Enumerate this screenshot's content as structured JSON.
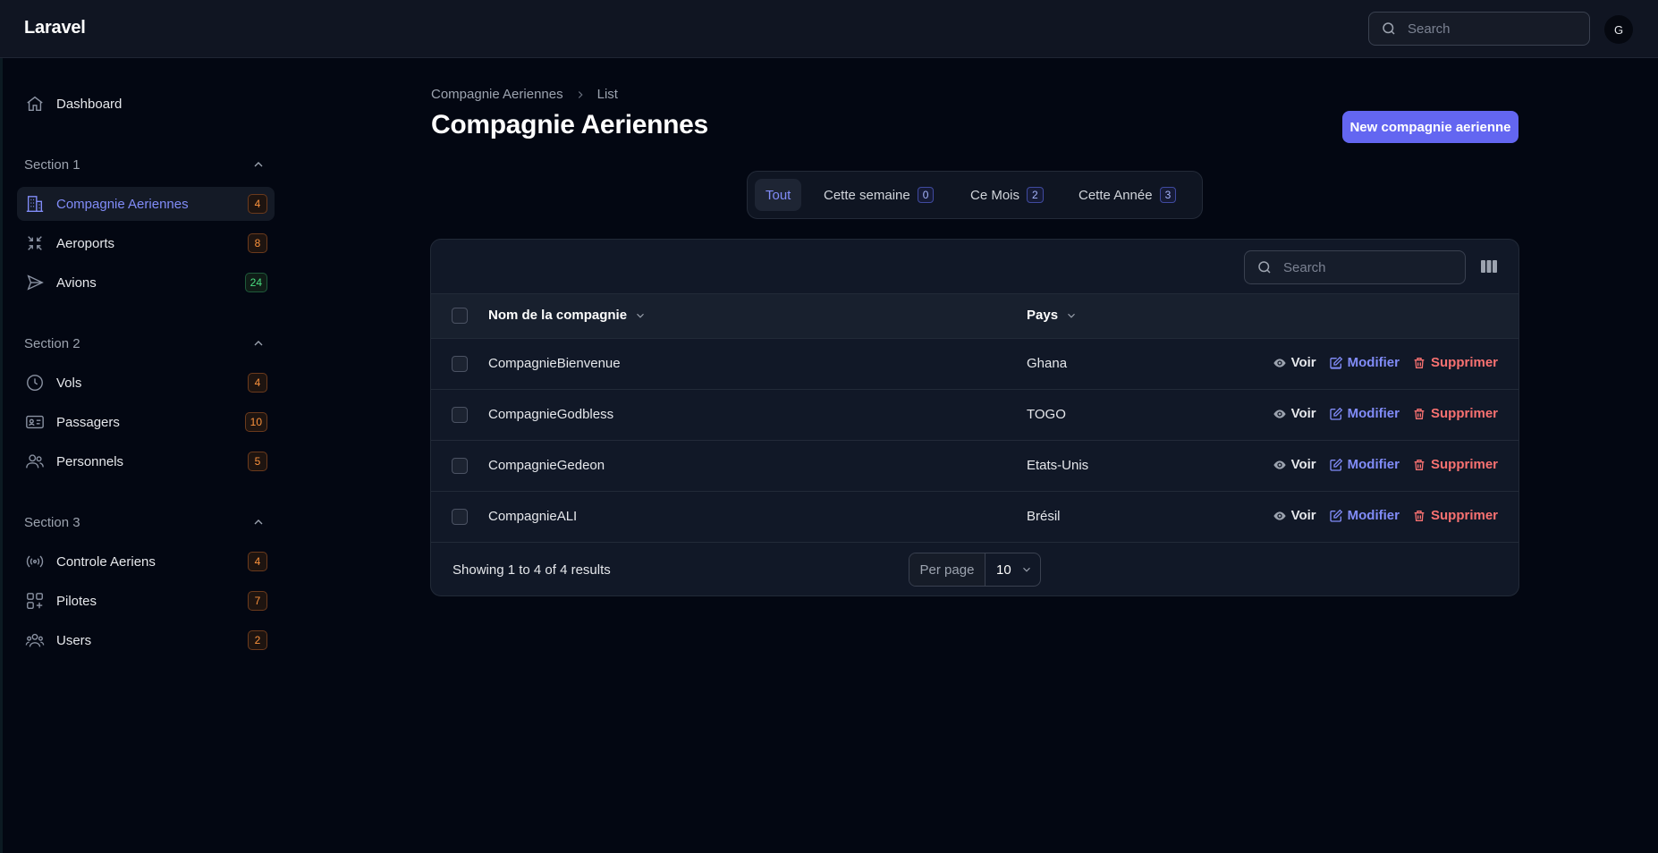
{
  "app": {
    "brand": "Laravel",
    "avatar_initial": "G"
  },
  "top_search": {
    "placeholder": "Search"
  },
  "sidebar": {
    "dashboard": {
      "label": "Dashboard",
      "icon": "home-icon"
    },
    "sections": [
      {
        "title": "Section 1",
        "items": [
          {
            "label": "Compagnie Aeriennes",
            "badge": "4",
            "badge_color": "orange",
            "icon": "building-icon",
            "active": true
          },
          {
            "label": "Aeroports",
            "badge": "8",
            "badge_color": "orange",
            "icon": "arrows-pointing-in-icon"
          },
          {
            "label": "Avions",
            "badge": "24",
            "badge_color": "green",
            "icon": "paper-airplane-icon"
          }
        ]
      },
      {
        "title": "Section 2",
        "items": [
          {
            "label": "Vols",
            "badge": "4",
            "badge_color": "orange",
            "icon": "clock-icon"
          },
          {
            "label": "Passagers",
            "badge": "10",
            "badge_color": "orange",
            "icon": "identification-icon"
          },
          {
            "label": "Personnels",
            "badge": "5",
            "badge_color": "orange",
            "icon": "users-icon"
          }
        ]
      },
      {
        "title": "Section 3",
        "items": [
          {
            "label": "Controle Aeriens",
            "badge": "4",
            "badge_color": "orange",
            "icon": "signal-icon"
          },
          {
            "label": "Pilotes",
            "badge": "7",
            "badge_color": "orange",
            "icon": "squares-plus-icon"
          },
          {
            "label": "Users",
            "badge": "2",
            "badge_color": "orange",
            "icon": "user-group-icon"
          }
        ]
      }
    ]
  },
  "breadcrumb": {
    "parent": "Compagnie Aeriennes",
    "current": "List"
  },
  "page": {
    "title": "Compagnie Aeriennes",
    "new_button": "New compagnie aerienne"
  },
  "tabs": [
    {
      "label": "Tout",
      "active": true
    },
    {
      "label": "Cette semaine",
      "count": "0"
    },
    {
      "label": "Ce Mois",
      "count": "2"
    },
    {
      "label": "Cette Année",
      "count": "3"
    }
  ],
  "table": {
    "search_placeholder": "Search",
    "columns": {
      "name": "Nom de la compagnie",
      "country": "Pays"
    },
    "actions": {
      "view": "Voir",
      "edit": "Modifier",
      "delete": "Supprimer"
    },
    "rows": [
      {
        "name": "CompagnieBienvenue",
        "country": "Ghana"
      },
      {
        "name": "CompagnieGodbless",
        "country": "TOGO"
      },
      {
        "name": "CompagnieGedeon",
        "country": "Etats-Unis"
      },
      {
        "name": "CompagnieALI",
        "country": "Brésil"
      }
    ],
    "footer": {
      "showing": "Showing 1 to 4 of 4 results",
      "per_page_label": "Per page",
      "per_page_value": "10"
    }
  },
  "colors": {
    "accent": "#6366f1",
    "accent_text": "#818cf8",
    "danger": "#f87171",
    "badge_orange": "#fb923c",
    "badge_green": "#4ade80"
  }
}
